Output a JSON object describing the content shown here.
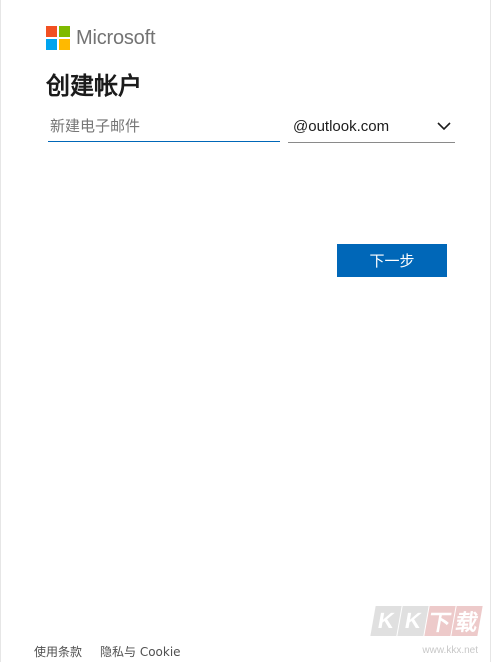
{
  "brand": {
    "name": "Microsoft",
    "colors": {
      "red": "#f25022",
      "green": "#7fba00",
      "blue": "#00a4ef",
      "yellow": "#ffb900"
    }
  },
  "page": {
    "title": "创建帐户"
  },
  "form": {
    "email_placeholder": "新建电子邮件",
    "email_value": "",
    "domain_selected": "@outlook.com",
    "domain_icon": "chevron-down-icon",
    "next_label": "下一步",
    "accent_color": "#0067b8"
  },
  "footer": {
    "terms_label": "使用条款",
    "privacy_label": "隐私与 Cookie"
  },
  "watermark": {
    "chars": [
      "K",
      "K",
      "下",
      "载"
    ],
    "url": "www.kkx.net"
  }
}
